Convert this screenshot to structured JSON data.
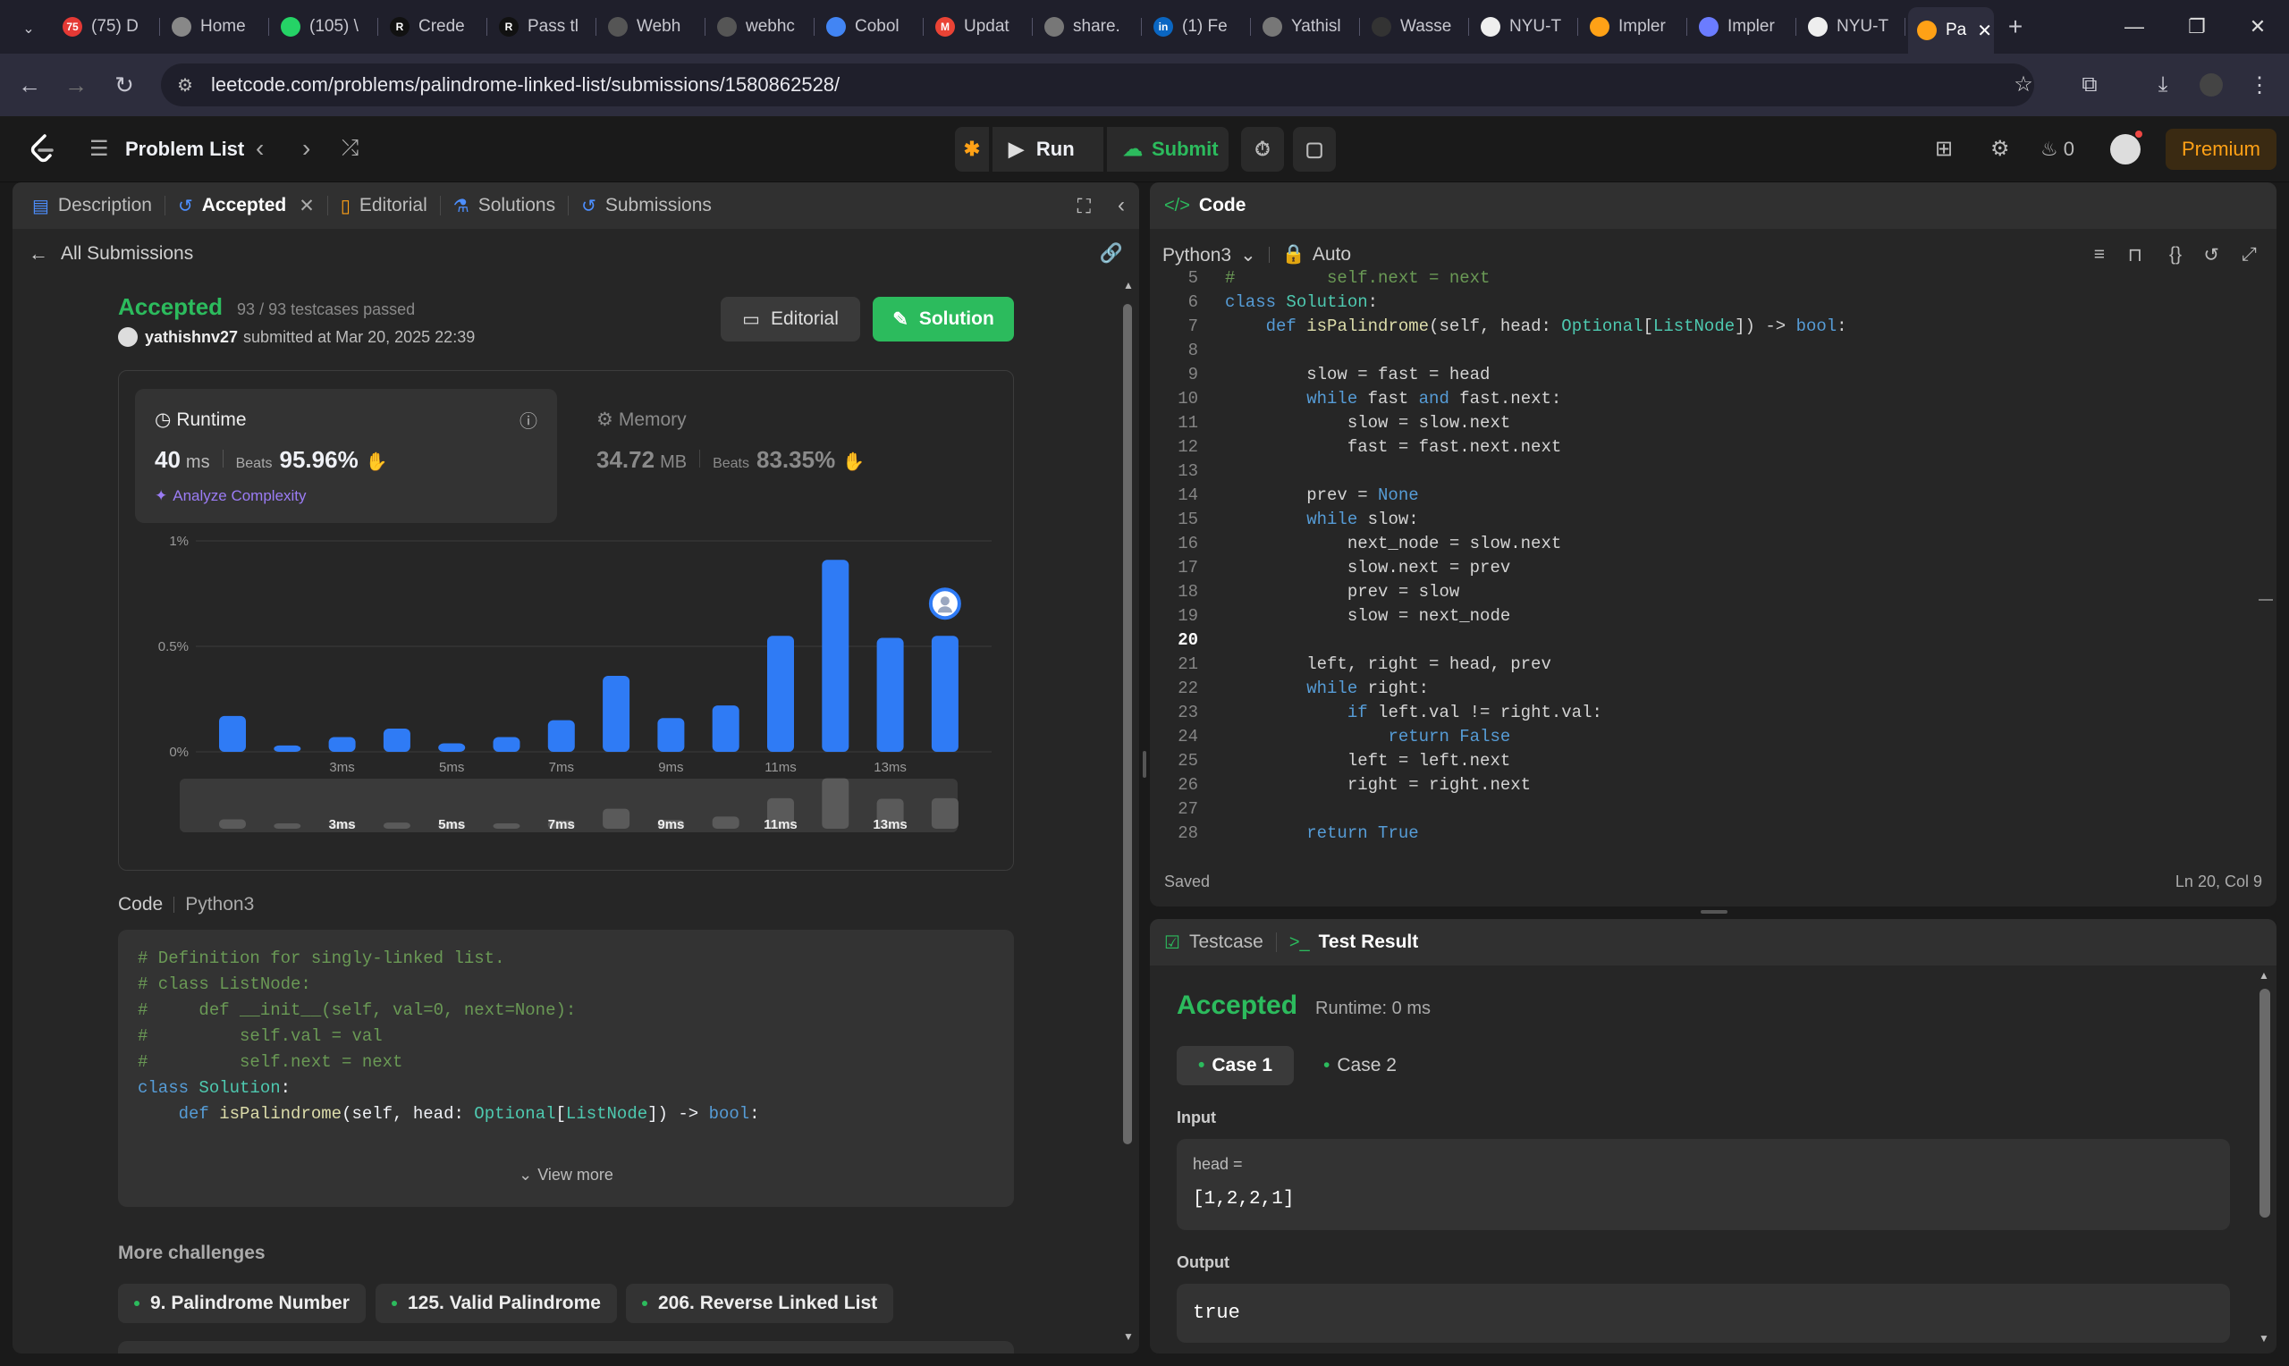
{
  "browser": {
    "tabs": [
      {
        "label": "(75) D",
        "icon": "youtube-icon",
        "color": "#e53935",
        "text": "75"
      },
      {
        "label": "Home",
        "icon": "globe-icon",
        "color": "#888888",
        "text": ""
      },
      {
        "label": "(105) \\",
        "icon": "whatsapp-icon",
        "color": "#25d366",
        "text": ""
      },
      {
        "label": "Crede",
        "icon": "r-icon",
        "color": "#111111",
        "text": "R"
      },
      {
        "label": "Pass tl",
        "icon": "r-icon",
        "color": "#111111",
        "text": "R"
      },
      {
        "label": "Webh",
        "icon": "webhook-icon",
        "color": "#555555",
        "text": ""
      },
      {
        "label": "webhc",
        "icon": "webhook-icon",
        "color": "#555555",
        "text": ""
      },
      {
        "label": "Cobol",
        "icon": "docs-icon",
        "color": "#4285f4",
        "text": ""
      },
      {
        "label": "Updat",
        "icon": "gmail-icon",
        "color": "#ea4335",
        "text": "M"
      },
      {
        "label": "share.",
        "icon": "globe-icon",
        "color": "#777777",
        "text": ""
      },
      {
        "label": "(1) Fe",
        "icon": "linkedin-icon",
        "color": "#0a66c2",
        "text": "in"
      },
      {
        "label": "Yathisl",
        "icon": "globe-icon",
        "color": "#777777",
        "text": ""
      },
      {
        "label": "Wasse",
        "icon": "app-icon",
        "color": "#333333",
        "text": ""
      },
      {
        "label": "NYU-T",
        "icon": "github-icon",
        "color": "#eeeeee",
        "text": ""
      },
      {
        "label": "Impler",
        "icon": "leetcode-icon",
        "color": "#ffa116",
        "text": ""
      },
      {
        "label": "Impler",
        "icon": "gemini-icon",
        "color": "#6b7cff",
        "text": ""
      },
      {
        "label": "NYU-T",
        "icon": "github-icon",
        "color": "#eeeeee",
        "text": ""
      },
      {
        "label": "Pa",
        "icon": "leetcode-icon",
        "color": "#ffa116",
        "text": ""
      }
    ],
    "new_tab": "+",
    "url": "leetcode.com/problems/palindrome-linked-list/submissions/1580862528/"
  },
  "header": {
    "problem_list": "Problem List",
    "run": "Run",
    "submit": "Submit",
    "streak": "0",
    "premium": "Premium"
  },
  "left": {
    "tabs": [
      "Description",
      "Accepted",
      "Editorial",
      "Solutions",
      "Submissions"
    ],
    "all_submissions": "All Submissions",
    "status": "Accepted",
    "testcases": "93 / 93 testcases passed",
    "user": "yathishnv27",
    "submitted": "submitted at Mar 20, 2025 22:39",
    "editorial_btn": "Editorial",
    "solution_btn": "Solution",
    "runtime_label": "Runtime",
    "runtime_value": "40",
    "runtime_unit": "ms",
    "beats_label": "Beats",
    "runtime_beats": "95.96%",
    "analyze": "Analyze Complexity",
    "memory_label": "Memory",
    "memory_value": "34.72",
    "memory_unit": "MB",
    "memory_beats": "83.35%",
    "code_label": "Code",
    "code_lang": "Python3",
    "view_more": "View more",
    "more_challenges": "More challenges",
    "challenges": [
      "9. Palindrome Number",
      "125. Valid Palindrome",
      "206. Reverse Linked List"
    ]
  },
  "chart_data": {
    "type": "bar",
    "yticks": [
      "1%",
      "0.5%",
      "0%"
    ],
    "ylim": [
      0,
      1
    ],
    "categories": [
      "1ms",
      "2ms",
      "3ms",
      "4ms",
      "5ms",
      "6ms",
      "7ms",
      "8ms",
      "9ms",
      "10ms",
      "11ms",
      "12ms",
      "13ms",
      "14ms"
    ],
    "xtick_labels": [
      "3ms",
      "5ms",
      "7ms",
      "9ms",
      "11ms",
      "13ms"
    ],
    "values": [
      0.17,
      0.03,
      0.07,
      0.11,
      0.04,
      0.07,
      0.15,
      0.36,
      0.16,
      0.22,
      0.55,
      0.91,
      0.54,
      0.55
    ],
    "highlight_index": 13,
    "bar_color": "#2f7bf5",
    "overview_color": "#5a5a5a"
  },
  "left_code": [
    "# Definition for singly-linked list.",
    "# class ListNode:",
    "#     def __init__(self, val=0, next=None):",
    "#         self.val = val",
    "#         self.next = next",
    "class Solution:",
    "    def isPalindrome(self, head: Optional[ListNode]) -> bool:"
  ],
  "editor": {
    "title": "Code",
    "lang": "Python3",
    "auto": "Auto",
    "status": "Saved",
    "cursor": "Ln 20, Col 9",
    "start_line": 5,
    "lines": [
      "#         self.next = next",
      "class Solution:",
      "    def isPalindrome(self, head: Optional[ListNode]) -> bool:",
      "",
      "        slow = fast = head",
      "        while fast and fast.next:",
      "            slow = slow.next",
      "            fast = fast.next.next",
      "",
      "        prev = None",
      "        while slow:",
      "            next_node = slow.next",
      "            slow.next = prev",
      "            prev = slow",
      "            slow = next_node",
      "",
      "        left, right = head, prev",
      "        while right:",
      "            if left.val != right.val:",
      "                return False",
      "            left = left.next",
      "            right = right.next",
      "",
      "        return True"
    ]
  },
  "testpanel": {
    "tab_testcase": "Testcase",
    "tab_result": "Test Result",
    "status": "Accepted",
    "runtime": "Runtime: 0 ms",
    "cases": [
      "Case 1",
      "Case 2"
    ],
    "input_label": "Input",
    "var_name": "head =",
    "var_value": "[1,2,2,1]",
    "output_label": "Output",
    "output_value": "true"
  }
}
